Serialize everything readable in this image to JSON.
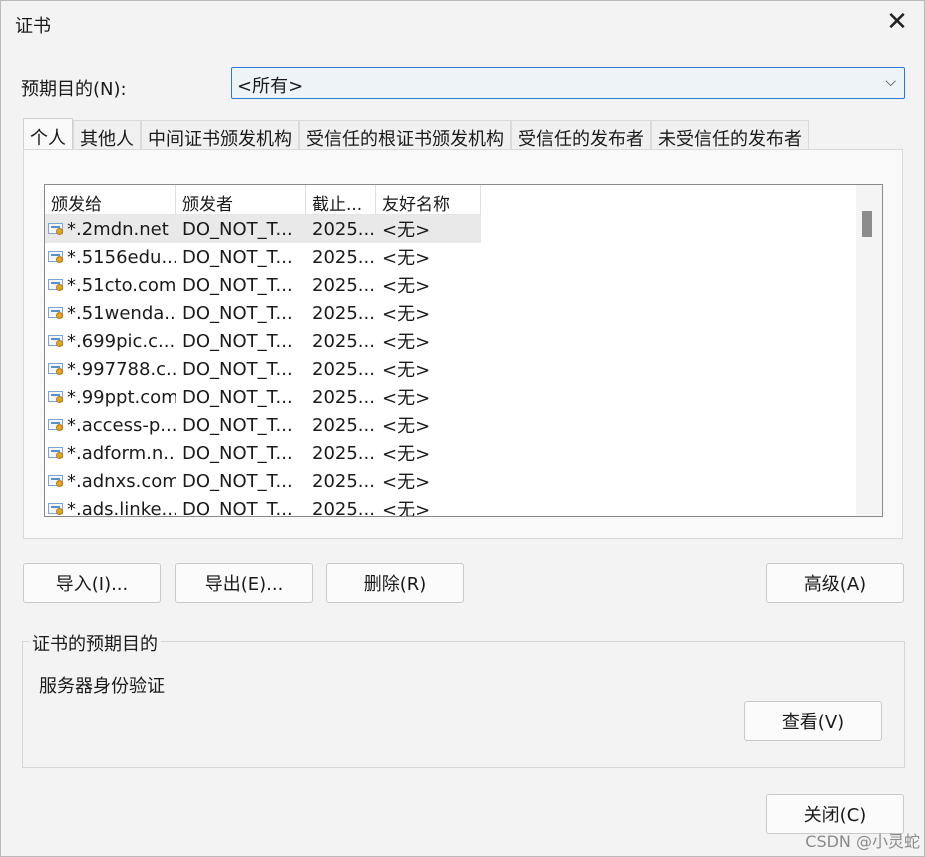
{
  "window": {
    "title": "证书",
    "close_icon": "✕"
  },
  "purpose": {
    "label": "预期目的(N):",
    "selected": "<所有>",
    "chevron": "⌵"
  },
  "tabs": [
    {
      "label": "个人",
      "active": true
    },
    {
      "label": "其他人"
    },
    {
      "label": "中间证书颁发机构"
    },
    {
      "label": "受信任的根证书颁发机构"
    },
    {
      "label": "受信任的发布者"
    },
    {
      "label": "未受信任的发布者"
    }
  ],
  "list": {
    "headers": [
      "颁发给",
      "颁发者",
      "截止...",
      "友好名称"
    ],
    "rows": [
      {
        "issued_to": "*.2mdn.net",
        "issuer": "DO_NOT_T...",
        "expires": "2025...",
        "friendly": "<无>"
      },
      {
        "issued_to": "*.5156edu....",
        "issuer": "DO_NOT_T...",
        "expires": "2025...",
        "friendly": "<无>"
      },
      {
        "issued_to": "*.51cto.com",
        "issuer": "DO_NOT_T...",
        "expires": "2025...",
        "friendly": "<无>"
      },
      {
        "issued_to": "*.51wenda...",
        "issuer": "DO_NOT_T...",
        "expires": "2025...",
        "friendly": "<无>"
      },
      {
        "issued_to": "*.699pic.c...",
        "issuer": "DO_NOT_T...",
        "expires": "2025...",
        "friendly": "<无>"
      },
      {
        "issued_to": "*.997788.c...",
        "issuer": "DO_NOT_T...",
        "expires": "2025...",
        "friendly": "<无>"
      },
      {
        "issued_to": "*.99ppt.com",
        "issuer": "DO_NOT_T...",
        "expires": "2025...",
        "friendly": "<无>"
      },
      {
        "issued_to": "*.access-p...",
        "issuer": "DO_NOT_T...",
        "expires": "2025...",
        "friendly": "<无>"
      },
      {
        "issued_to": "*.adform.n...",
        "issuer": "DO_NOT_T...",
        "expires": "2025...",
        "friendly": "<无>"
      },
      {
        "issued_to": "*.adnxs.com",
        "issuer": "DO_NOT_T...",
        "expires": "2025...",
        "friendly": "<无>"
      },
      {
        "issued_to": "*.ads.linke...",
        "issuer": "DO_NOT_T...",
        "expires": "2025...",
        "friendly": "<无>"
      }
    ]
  },
  "buttons": {
    "import": "导入(I)...",
    "export": "导出(E)...",
    "remove": "删除(R)",
    "advanced": "高级(A)",
    "view": "查看(V)",
    "close": "关闭(C)"
  },
  "purposes_group": {
    "title": "证书的预期目的",
    "text": "服务器身份验证"
  },
  "watermark": "CSDN @小灵蛇"
}
